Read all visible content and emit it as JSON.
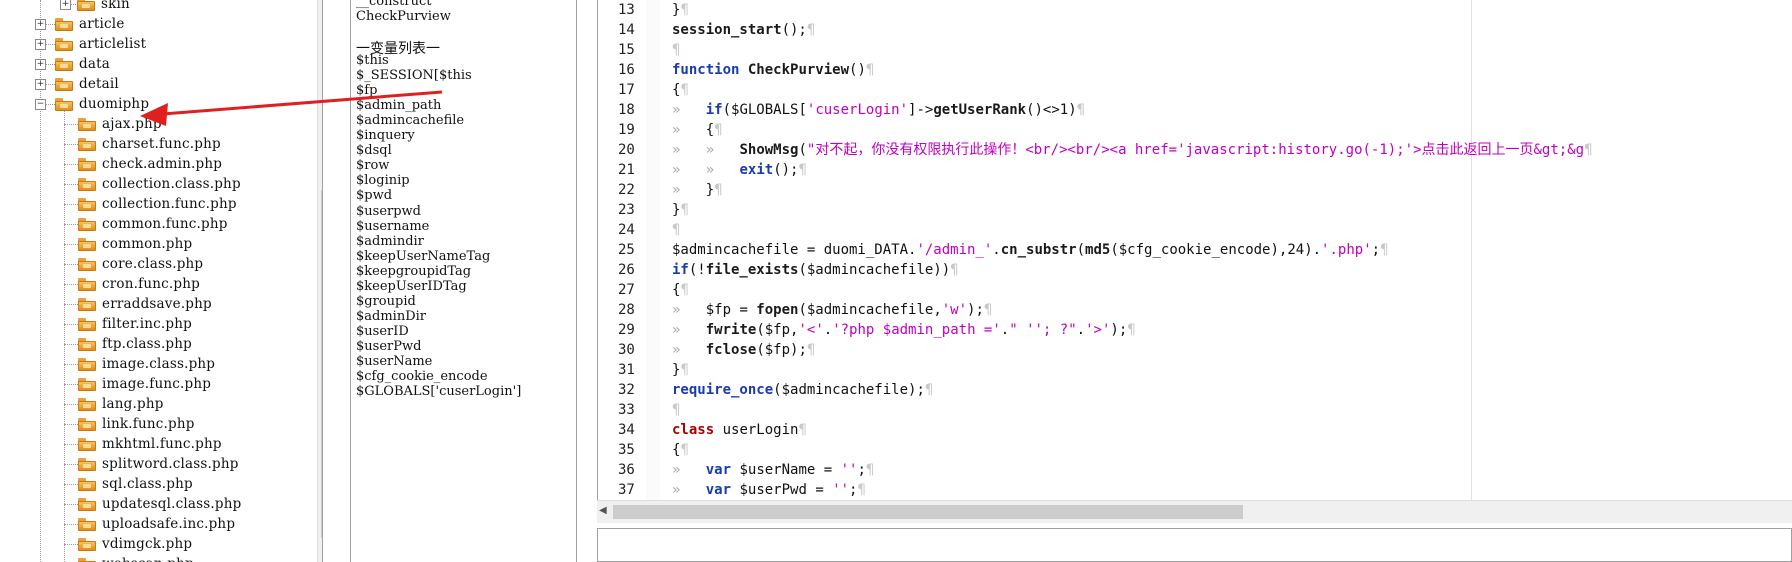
{
  "tree": {
    "items": [
      {
        "label": "skin",
        "level": 3,
        "expander": "+"
      },
      {
        "label": "article",
        "level": 2,
        "expander": "+"
      },
      {
        "label": "articlelist",
        "level": 2,
        "expander": "+"
      },
      {
        "label": "data",
        "level": 2,
        "expander": "+"
      },
      {
        "label": "detail",
        "level": 2,
        "expander": "+"
      },
      {
        "label": "duomiphp",
        "level": 2,
        "expander": "-"
      },
      {
        "label": "ajax.php",
        "level": 3
      },
      {
        "label": "charset.func.php",
        "level": 3
      },
      {
        "label": "check.admin.php",
        "level": 3
      },
      {
        "label": "collection.class.php",
        "level": 3
      },
      {
        "label": "collection.func.php",
        "level": 3
      },
      {
        "label": "common.func.php",
        "level": 3
      },
      {
        "label": "common.php",
        "level": 3
      },
      {
        "label": "core.class.php",
        "level": 3
      },
      {
        "label": "cron.func.php",
        "level": 3
      },
      {
        "label": "erraddsave.php",
        "level": 3
      },
      {
        "label": "filter.inc.php",
        "level": 3
      },
      {
        "label": "ftp.class.php",
        "level": 3
      },
      {
        "label": "image.class.php",
        "level": 3
      },
      {
        "label": "image.func.php",
        "level": 3
      },
      {
        "label": "lang.php",
        "level": 3
      },
      {
        "label": "link.func.php",
        "level": 3
      },
      {
        "label": "mkhtml.func.php",
        "level": 3
      },
      {
        "label": "splitword.class.php",
        "level": 3
      },
      {
        "label": "sql.class.php",
        "level": 3
      },
      {
        "label": "updatesql.class.php",
        "level": 3
      },
      {
        "label": "uploadsafe.inc.php",
        "level": 3
      },
      {
        "label": "vdimgck.php",
        "level": 3
      },
      {
        "label": "webscan.php",
        "level": 3
      }
    ]
  },
  "vars": {
    "top_lines": [
      "__construct",
      "CheckPurview"
    ],
    "heading": "一变量列表一",
    "items": [
      "$this",
      "$_SESSION[$this",
      "$fp",
      "$admin_path",
      "$admincachefile",
      "$inquery",
      "$dsql",
      "$row",
      "$loginip",
      "$pwd",
      "$userpwd",
      "$username",
      "$admindir",
      "$keepUserNameTag",
      "$keepgroupidTag",
      "$keepUserIDTag",
      "$groupid",
      "$adminDir",
      "$userID",
      "$userPwd",
      "$userName",
      "$cfg_cookie_encode",
      "$GLOBALS['cuserLogin']"
    ]
  },
  "editor": {
    "line_numbers": [
      "13",
      "14",
      "15",
      "16",
      "17",
      "18",
      "19",
      "20",
      "21",
      "22",
      "23",
      "24",
      "25",
      "26",
      "27",
      "28",
      "29",
      "30",
      "31",
      "32",
      "33",
      "34",
      "35",
      "36",
      "37"
    ],
    "lines": [
      {
        "t": "}"
      },
      {
        "t": "session_start();"
      },
      {
        "t": ""
      },
      {
        "t": "function CheckPurview()"
      },
      {
        "t": "{"
      },
      {
        "t": "\tif($GLOBALS['cuserLogin']->getUserRank()<>1)"
      },
      {
        "t": "\t{"
      },
      {
        "t": "\t\tShowMsg(\"对不起，你没有权限执行此操作！<br/><br/><a href='javascript:history.go(-1);'>点击此返回上一页&gt;&g"
      },
      {
        "t": "\t\texit();"
      },
      {
        "t": "\t}"
      },
      {
        "t": "}"
      },
      {
        "t": ""
      },
      {
        "t": "$admincachefile = duomi_DATA.'/admin_'.cn_substr(md5($cfg_cookie_encode),24).'.php';"
      },
      {
        "t": "if(!file_exists($admincachefile))"
      },
      {
        "t": "{"
      },
      {
        "t": "\t$fp = fopen($admincachefile,'w');"
      },
      {
        "t": "\tfwrite($fp,'<'.'?php $admin_path ='.\" ''; ?\".'>');"
      },
      {
        "t": "\tfclose($fp);"
      },
      {
        "t": "}"
      },
      {
        "t": "require_once($admincachefile);"
      },
      {
        "t": ""
      },
      {
        "t": "class userLogin"
      },
      {
        "t": "{"
      },
      {
        "t": "\tvar $userName = '';"
      },
      {
        "t": "\tvar $userPwd = '';"
      }
    ]
  },
  "colors": {
    "keyword": "#1a3ab0",
    "string": "#c000c0",
    "class_kw": "#aa0000",
    "annotation": "#e02020"
  },
  "icons": {
    "folder": "folder-icon",
    "expander_plus": "plus-box-icon",
    "expander_minus": "minus-box-icon"
  }
}
